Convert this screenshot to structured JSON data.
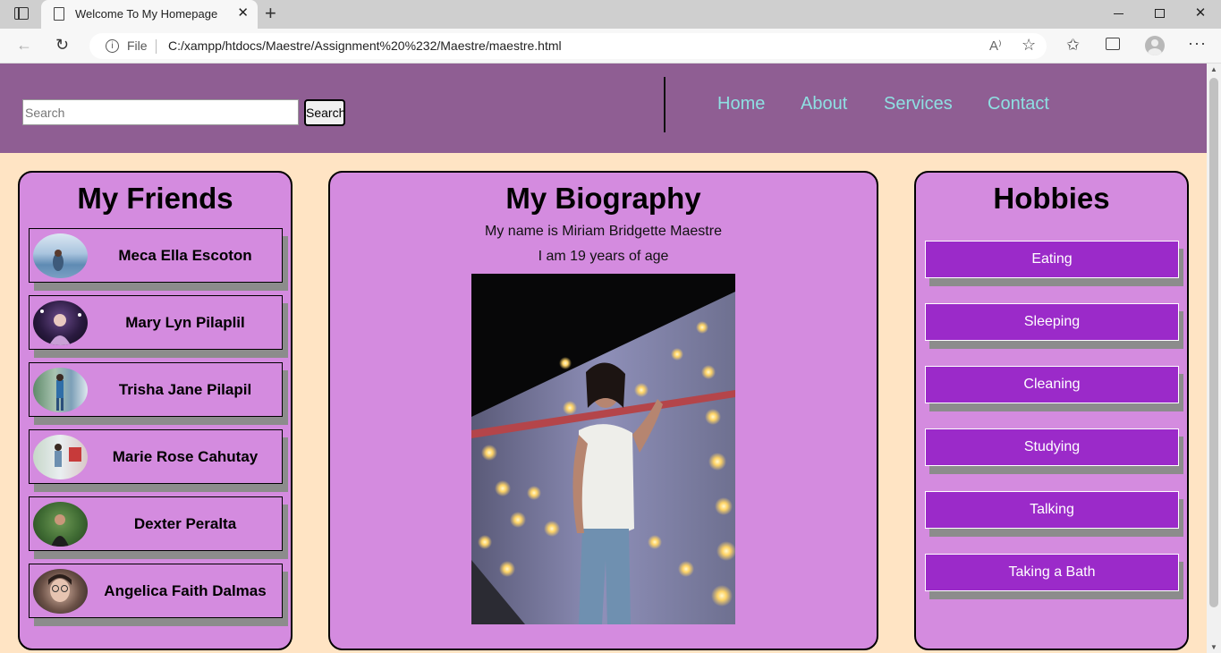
{
  "browser": {
    "tab_title": "Welcome To My Homepage",
    "new_tab_symbol": "+",
    "close_tab_symbol": "✕",
    "file_label": "File",
    "url": "C:/xampp/htdocs/Maestre/Assignment%20%232/Maestre/maestre.html",
    "icons": [
      "tab-actions-icon",
      "page-icon",
      "close-icon",
      "plus-icon",
      "back-icon",
      "reload-icon",
      "info-icon",
      "read-aloud-icon",
      "add-favorite-icon",
      "favorites-icon",
      "collections-icon",
      "profile-icon",
      "more-icon",
      "minimize-icon",
      "restore-icon",
      "window-close-icon"
    ]
  },
  "header": {
    "search_placeholder": "Search",
    "search_button": "Search",
    "nav": [
      "Home",
      "About",
      "Services",
      "Contact"
    ],
    "colors": {
      "background": "#8f5e93",
      "link": "#8ee0e2"
    }
  },
  "friends": {
    "title": "My Friends",
    "items": [
      {
        "name": "Meca Ella Escoton"
      },
      {
        "name": "Mary Lyn Pilaplil"
      },
      {
        "name": "Trisha Jane Pilapil"
      },
      {
        "name": "Marie Rose Cahutay"
      },
      {
        "name": "Dexter Peralta"
      },
      {
        "name": "Angelica Faith Dalmas"
      }
    ]
  },
  "biography": {
    "title": "My Biography",
    "line1": "My name is Miriam Bridgette Maestre",
    "line2": "I am 19 years of age"
  },
  "hobbies": {
    "title": "Hobbies",
    "items": [
      "Eating",
      "Sleeping",
      "Cleaning",
      "Studying",
      "Talking",
      "Taking a Bath"
    ],
    "colors": {
      "button": "#9b2ac9",
      "shadow": "#8c8c8c"
    }
  },
  "theme": {
    "page_background": "#ffe4c4",
    "panel_background": "#d48bdf"
  }
}
